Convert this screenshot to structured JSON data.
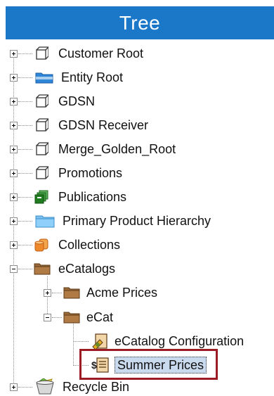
{
  "header": {
    "title": "Tree"
  },
  "tree": {
    "items": [
      {
        "label": "Customer Root"
      },
      {
        "label": "Entity Root"
      },
      {
        "label": "GDSN"
      },
      {
        "label": "GDSN Receiver"
      },
      {
        "label": "Merge_Golden_Root"
      },
      {
        "label": "Promotions"
      },
      {
        "label": "Publications"
      },
      {
        "label": "Primary Product Hierarchy"
      },
      {
        "label": "Collections"
      },
      {
        "label": "eCatalogs"
      },
      {
        "label": "Acme Prices"
      },
      {
        "label": "eCat"
      },
      {
        "label": "eCatalog Configuration"
      },
      {
        "label": "Summer Prices"
      },
      {
        "label": "Recycle Bin"
      }
    ]
  },
  "colors": {
    "header_bg": "#1b78c9",
    "selection_bg": "#c9d9ee",
    "highlight_border": "#9b1c22"
  },
  "icons": {
    "customer_root": "cube-outline-icon",
    "entity_root": "blue-folder-icon",
    "gdsn": "cube-outline-icon",
    "gdsn_receiver": "cube-outline-icon",
    "merge_golden_root": "cube-outline-icon",
    "promotions": "cube-outline-icon",
    "publications": "green-stack-icon",
    "primary_product_hierarchy": "light-blue-folder-icon",
    "collections": "orange-cylinders-icon",
    "ecatalogs": "brown-folder-icon",
    "acme_prices": "brown-folder-icon",
    "ecat": "brown-folder-icon",
    "ecatalog_configuration": "gear-document-icon",
    "summer_prices": "price-list-icon",
    "recycle_bin": "recycle-bin-icon"
  }
}
